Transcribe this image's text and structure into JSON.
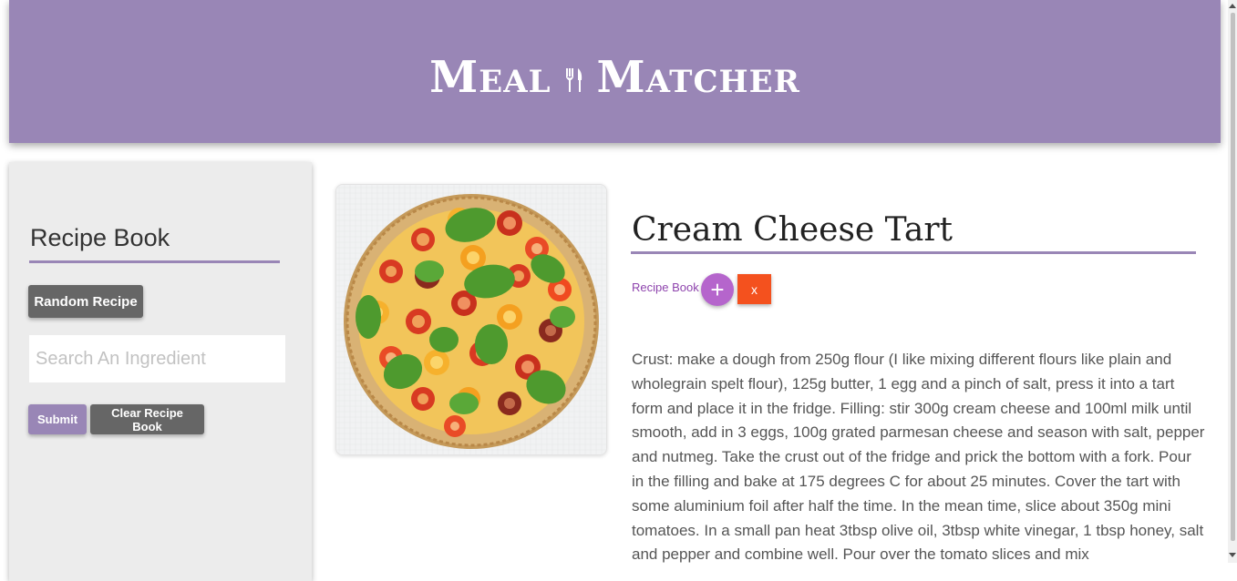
{
  "header": {
    "title_part1": "Meal",
    "title_part2": "Matcher",
    "icon": "utensils-icon",
    "color": "#9986b6"
  },
  "sidebar": {
    "title": "Recipe Book",
    "random_button": "Random Recipe",
    "search": {
      "placeholder": "Search An Ingredient",
      "value": ""
    },
    "submit_button": "Submit",
    "clear_button": "Clear Recipe Book"
  },
  "recipe": {
    "title": "Cream Cheese Tart",
    "recipe_book_label": "Recipe Book",
    "add_button": "+",
    "remove_button": "x",
    "image_alt_icon": "tomato-tart-image",
    "instructions": "Crust: make a dough from 250g flour (I like mixing different flours like plain and wholegrain spelt flour), 125g butter, 1 egg and a pinch of salt, press it into a tart form and place it in the fridge. Filling: stir 300g cream cheese and 100ml milk until smooth, add in 3 eggs, 100g grated parmesan cheese and season with salt, pepper and nutmeg. Take the crust out of the fridge and prick the bottom with a fork. Pour in the filling and bake at 175 degrees C for about 25 minutes. Cover the tart with some aluminium foil after half the time. In the mean time, slice about 350g mini tomatoes. In a small pan heat 3tbsp olive oil, 3tbsp white vinegar, 1 tbsp honey, salt and pepper and combine well. Pour over the tomato slices and mix"
  },
  "colors": {
    "accent": "#9986b6",
    "button_gray": "#666666",
    "add": "#b565cc",
    "remove": "#f4511e",
    "link": "#8e44ad"
  }
}
